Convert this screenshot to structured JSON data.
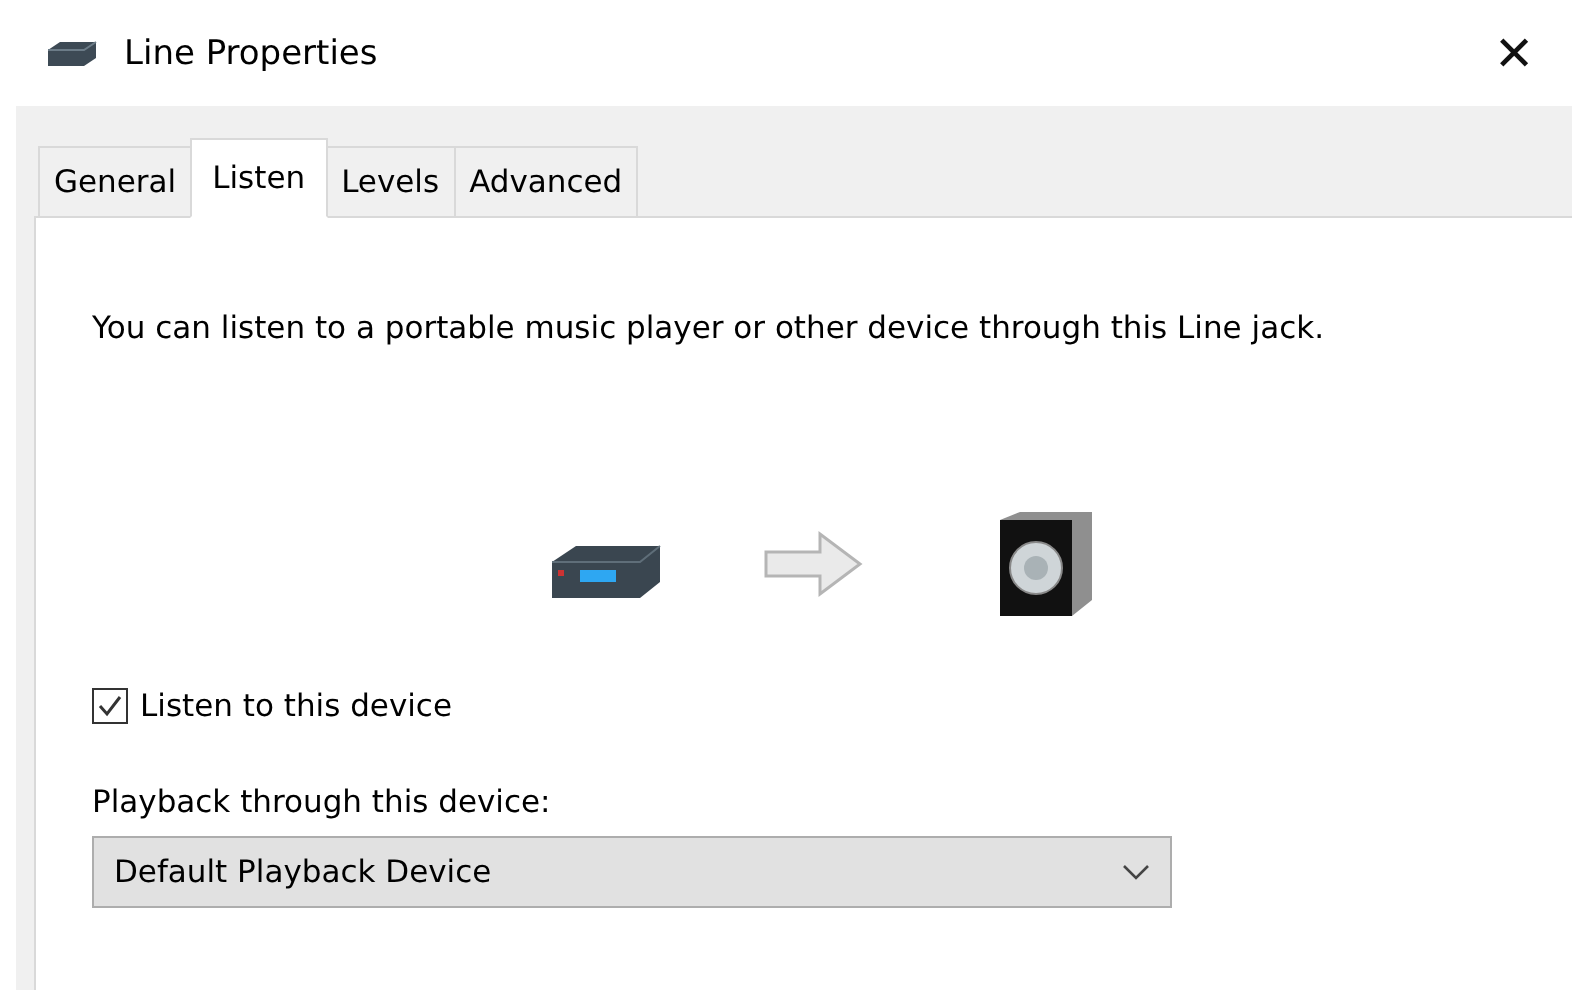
{
  "window": {
    "title": "Line Properties",
    "close": "✕"
  },
  "tabs": [
    {
      "label": "General",
      "selected": false
    },
    {
      "label": "Listen",
      "selected": true
    },
    {
      "label": "Levels",
      "selected": false
    },
    {
      "label": "Advanced",
      "selected": false
    }
  ],
  "description": "You can listen to a portable music player or other device through this Line jack.",
  "listen_checkbox": {
    "label": "Listen to this device",
    "checked": true
  },
  "playback": {
    "label": "Playback through this device:",
    "value": "Default Playback Device"
  }
}
